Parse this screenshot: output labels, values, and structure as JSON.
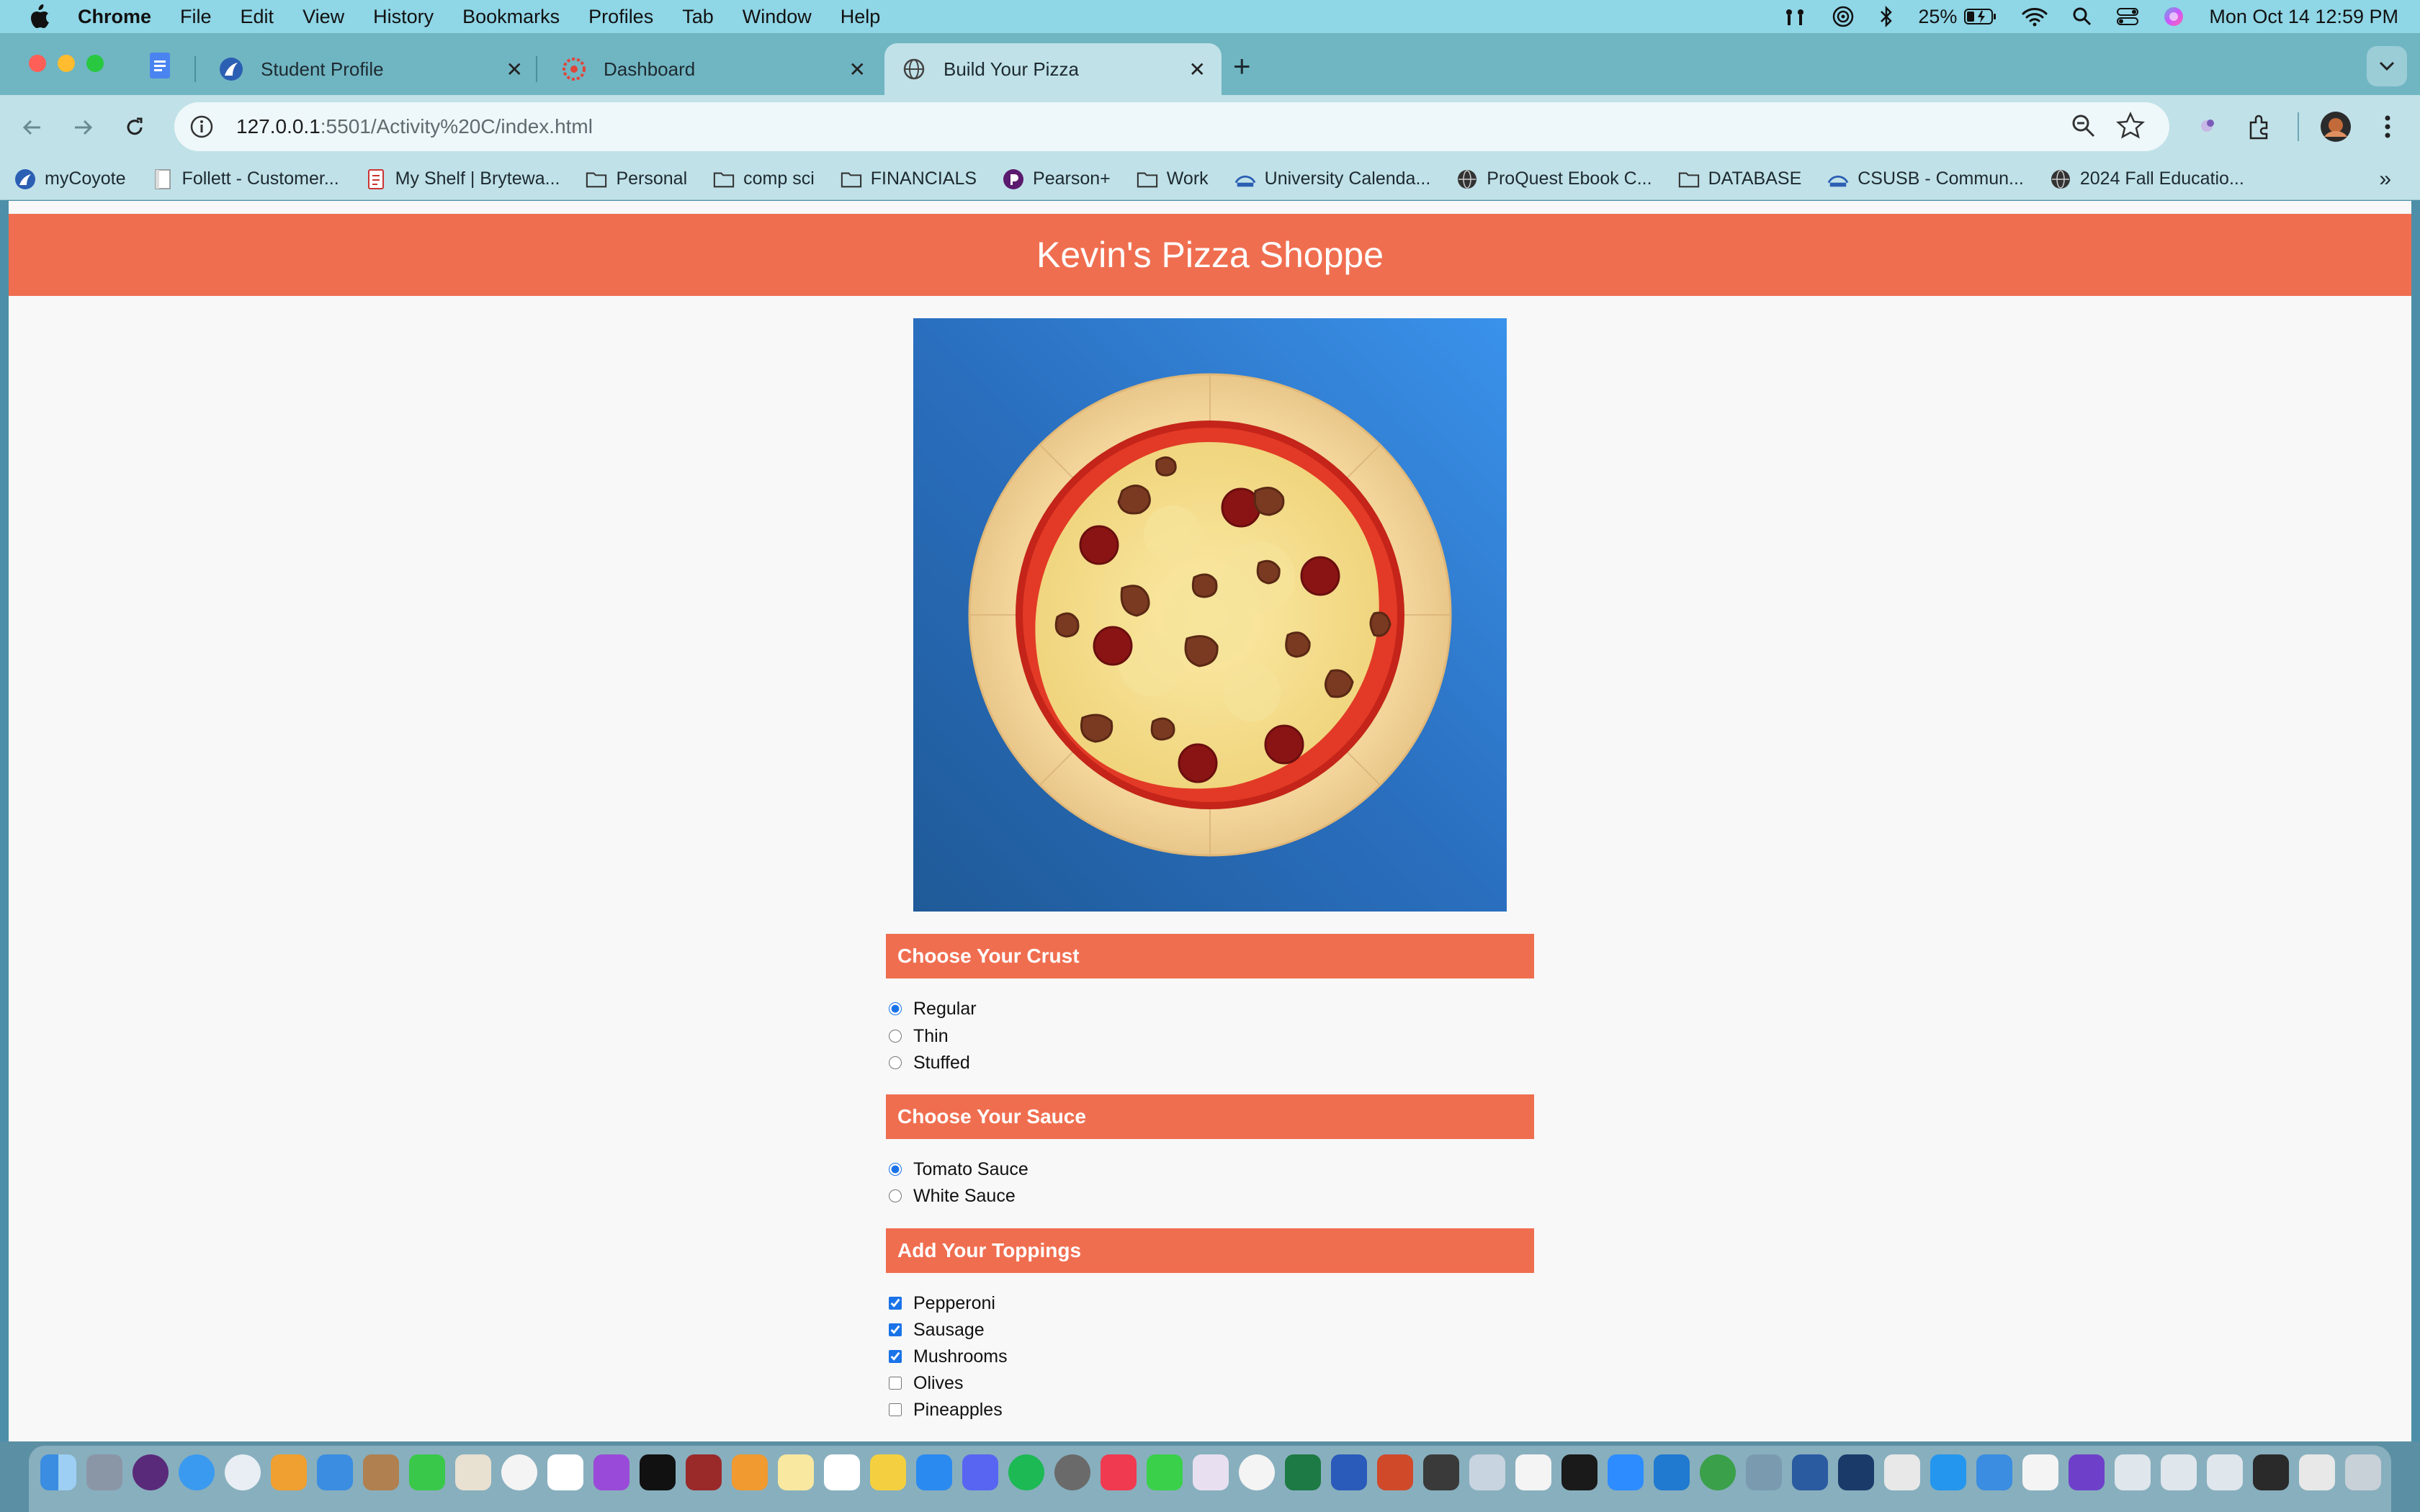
{
  "menubar": {
    "app_name": "Chrome",
    "items": [
      "File",
      "Edit",
      "View",
      "History",
      "Bookmarks",
      "Profiles",
      "Tab",
      "Window",
      "Help"
    ],
    "battery": "25%",
    "clock": "Mon Oct 14  12:59 PM"
  },
  "tabs": [
    {
      "title": "Student Profile"
    },
    {
      "title": "Dashboard"
    },
    {
      "title": "Build Your Pizza"
    }
  ],
  "toolbar": {
    "url_host": "127.0.0.1",
    "url_path": ":5501/Activity%20C/index.html"
  },
  "bookmarks": [
    {
      "label": "myCoyote",
      "icon": "coyote-icon"
    },
    {
      "label": "Follett - Customer...",
      "icon": "page-icon"
    },
    {
      "label": "My Shelf | Brytewa...",
      "icon": "document-icon"
    },
    {
      "label": "Personal",
      "icon": "folder-icon"
    },
    {
      "label": "comp sci",
      "icon": "folder-icon"
    },
    {
      "label": "FINANCIALS",
      "icon": "folder-icon"
    },
    {
      "label": "Pearson+",
      "icon": "pearson-icon"
    },
    {
      "label": "Work",
      "icon": "folder-icon"
    },
    {
      "label": "University Calenda...",
      "icon": "csusb-icon"
    },
    {
      "label": "ProQuest Ebook C...",
      "icon": "globe-icon"
    },
    {
      "label": "DATABASE",
      "icon": "folder-icon"
    },
    {
      "label": "CSUSB - Commun...",
      "icon": "csusb-icon"
    },
    {
      "label": "2024 Fall Educatio...",
      "icon": "globe-icon"
    }
  ],
  "page": {
    "title": "Kevin's Pizza Shoppe",
    "crust": {
      "heading": "Choose Your Crust",
      "options": [
        {
          "label": "Regular",
          "checked": true
        },
        {
          "label": "Thin",
          "checked": false
        },
        {
          "label": "Stuffed",
          "checked": false
        }
      ]
    },
    "sauce": {
      "heading": "Choose Your Sauce",
      "options": [
        {
          "label": "Tomato Sauce",
          "checked": true
        },
        {
          "label": "White Sauce",
          "checked": false
        }
      ]
    },
    "toppings": {
      "heading": "Add Your Toppings",
      "options": [
        {
          "label": "Pepperoni",
          "checked": true
        },
        {
          "label": "Sausage",
          "checked": true
        },
        {
          "label": "Mushrooms",
          "checked": true
        },
        {
          "label": "Olives",
          "checked": false
        },
        {
          "label": "Pineapples",
          "checked": false
        }
      ]
    }
  },
  "colors": {
    "accent": "#f06e50",
    "menubar": "#8fd6e6",
    "tabstrip": "#70b5c2",
    "toolbar": "#c0e1e8",
    "pizza_bg": "#2a6fbf"
  }
}
